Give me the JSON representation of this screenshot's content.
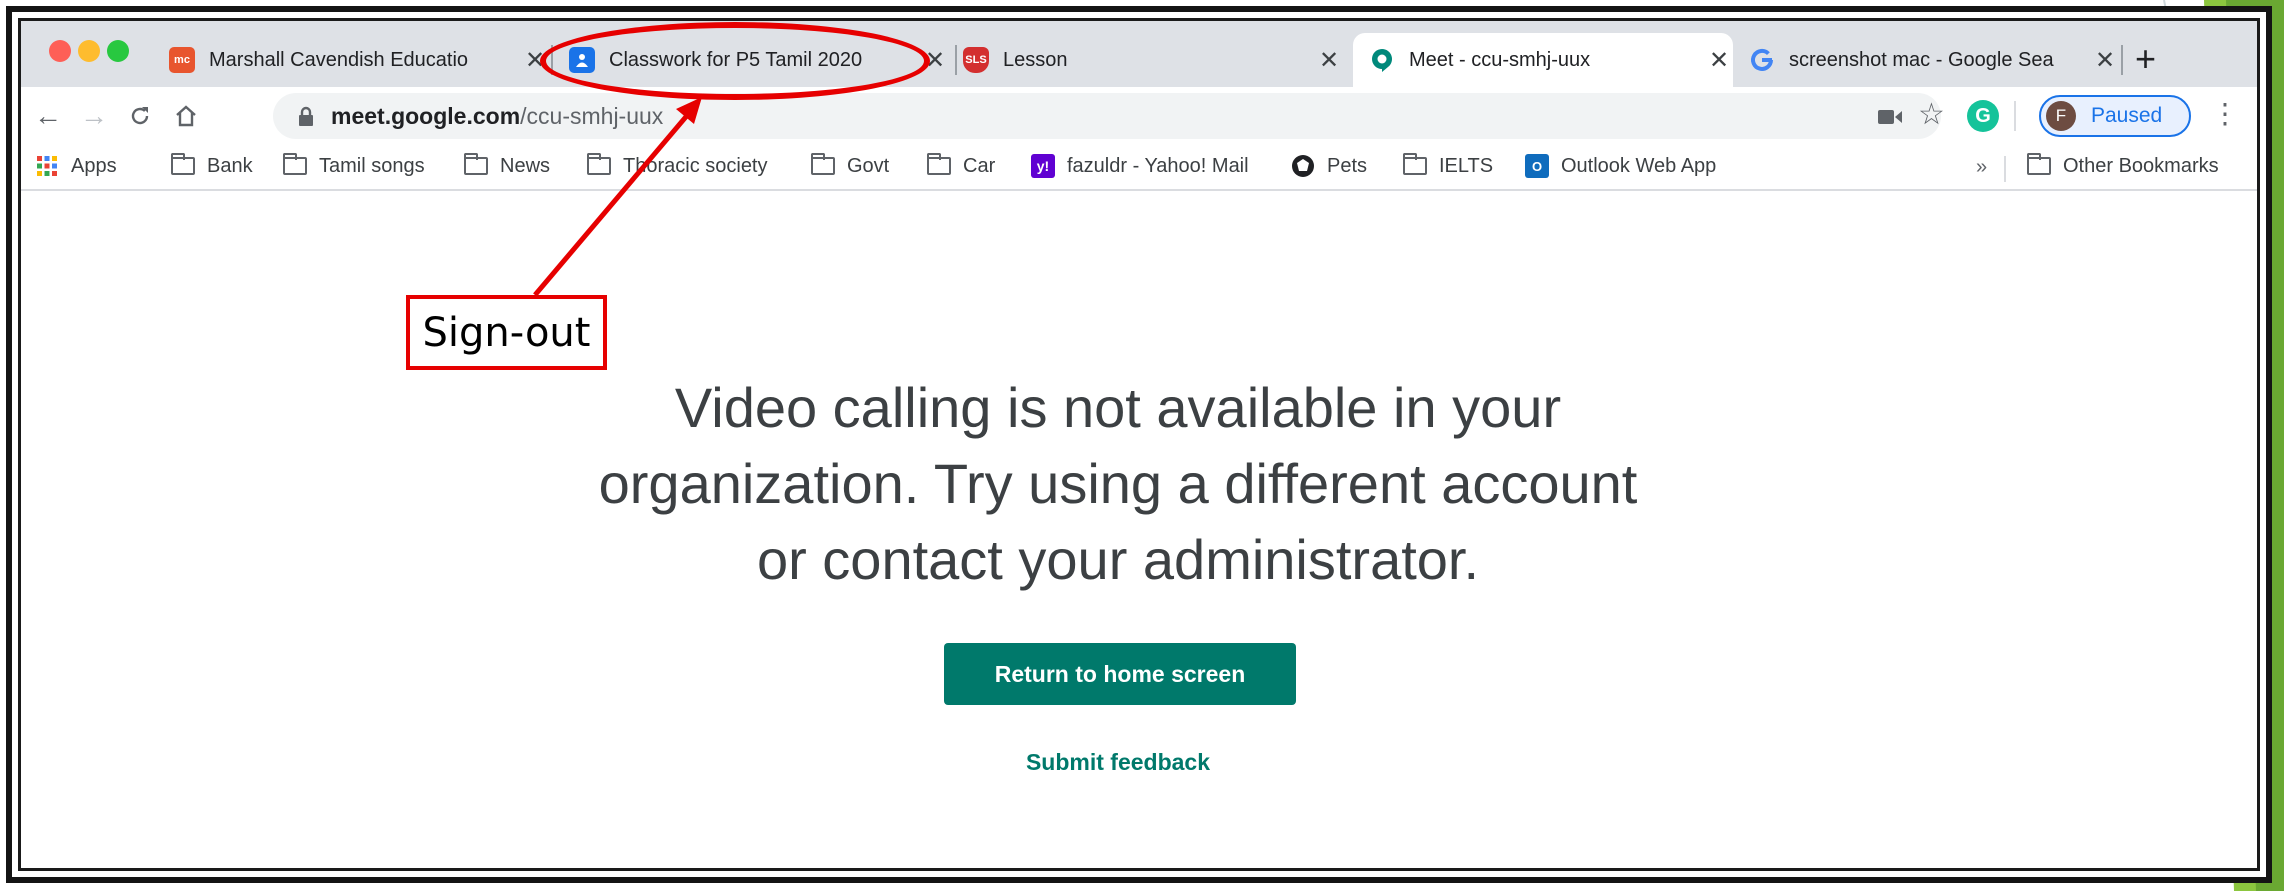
{
  "browser": {
    "tabs": [
      {
        "favicon": "marshall-cavendish-icon",
        "label": "Marshall Cavendish Educatio",
        "active": false
      },
      {
        "favicon": "google-classroom-icon",
        "label": "Classwork for P5 Tamil 2020",
        "active": false
      },
      {
        "favicon": "sls-icon",
        "label": "Lesson",
        "active": false
      },
      {
        "favicon": "google-meet-icon",
        "label": "Meet - ccu-smhj-uux",
        "active": true
      },
      {
        "favicon": "google-icon",
        "label": "screenshot mac - Google Sea",
        "active": false
      }
    ],
    "new_tab_symbol": "+",
    "address": {
      "host": "meet.google.com",
      "path": "/ccu-smhj-uux"
    },
    "profile": {
      "initial": "F",
      "label": "Paused"
    },
    "grammarly_letter": "G",
    "bookmarks": [
      {
        "icon": "apps-grid-icon",
        "label": "Apps"
      },
      {
        "icon": "folder-icon",
        "label": "Bank"
      },
      {
        "icon": "folder-icon",
        "label": "Tamil songs"
      },
      {
        "icon": "folder-icon",
        "label": "News"
      },
      {
        "icon": "folder-icon",
        "label": "Thoracic society"
      },
      {
        "icon": "folder-icon",
        "label": "Govt"
      },
      {
        "icon": "folder-icon",
        "label": "Car"
      },
      {
        "icon": "yahoo-mail-icon",
        "label": "fazuldr - Yahoo! Mail"
      },
      {
        "icon": "paw-icon",
        "label": "Pets"
      },
      {
        "icon": "folder-icon",
        "label": "IELTS"
      },
      {
        "icon": "outlook-icon",
        "label": "Outlook Web App"
      }
    ],
    "bookmarks_overflow": "»",
    "other_bookmarks": "Other Bookmarks"
  },
  "page": {
    "message_lines": [
      "Video calling is not available in your",
      "organization. Try using a different account",
      "or contact your administrator."
    ],
    "home_button": "Return to home screen",
    "feedback_link": "Submit feedback"
  },
  "annotation": {
    "label": "Sign-out",
    "color": "#e60000"
  },
  "colors": {
    "meet_teal": "#00796b",
    "slide_green": "#7ac143"
  }
}
